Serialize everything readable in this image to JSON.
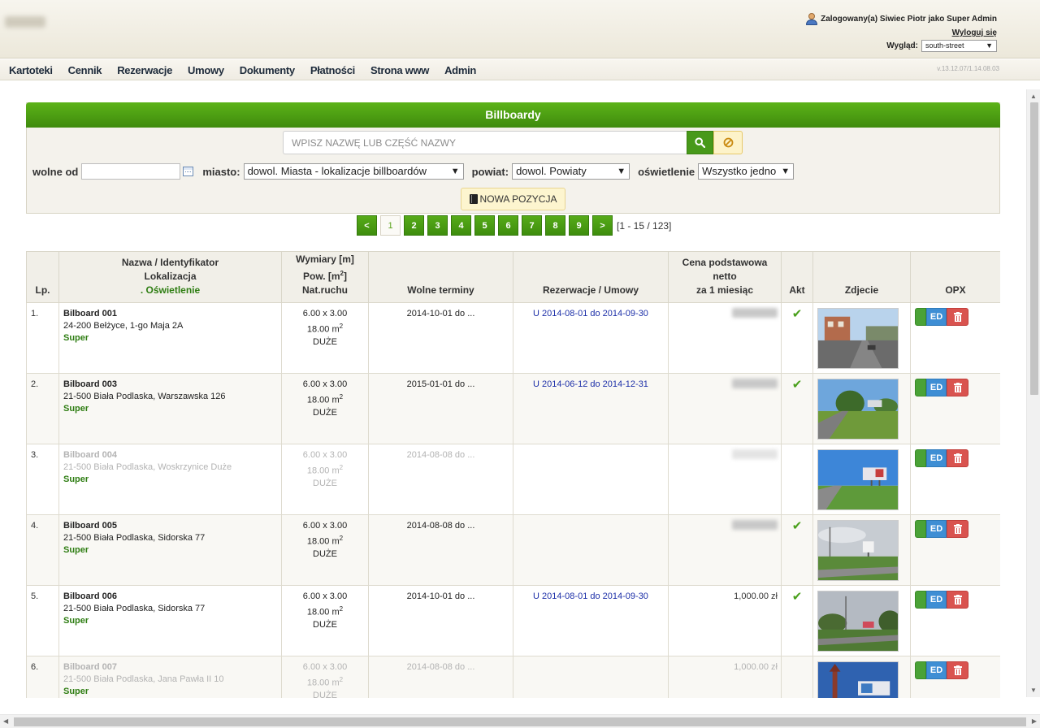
{
  "header": {
    "user_text": "Zalogowany(a) Siwiec Piotr jako Super Admin",
    "logout_label": "Wyloguj się",
    "look_label": "Wygląd:",
    "look_value": "south-street",
    "version": "v.13.12.07/1.14.08.03"
  },
  "menu": {
    "items": [
      "Kartoteki",
      "Cennik",
      "Rezerwacje",
      "Umowy",
      "Dokumenty",
      "Płatności",
      "Strona www",
      "Admin"
    ]
  },
  "panel": {
    "title": "Billboardy",
    "search_placeholder": "WPISZ NAZWĘ LUB CZĘŚĆ NAZWY",
    "filters": {
      "free_from_label": "wolne od",
      "city_label": "miasto:",
      "city_value": "dowol. Miasta - lokalizacje billboardów",
      "county_label": "powiat:",
      "county_value": "dowol. Powiaty",
      "lighting_label": "oświetlenie",
      "lighting_value": "Wszystko jedno"
    },
    "new_button": "NOWA POZYCJA"
  },
  "pager": {
    "prev": "<",
    "pages": [
      "1",
      "2",
      "3",
      "4",
      "5",
      "6",
      "7",
      "8",
      "9"
    ],
    "next": ">",
    "info": "[1 - 15 / 123]"
  },
  "table": {
    "headers": {
      "lp": "Lp.",
      "name_l1": "Nazwa / Identyfikator",
      "name_l2": "Lokalizacja",
      "name_l3": ". Oświetlenie",
      "dim_l1": "Wymiary [m]",
      "dim_l2": "Pow. [m",
      "dim_l2_sup": "2",
      "dim_l2_end": "]",
      "dim_l3": "Nat.ruchu",
      "free": "Wolne terminy",
      "res": "Rezerwacje / Umowy",
      "price_l1": "Cena podstawowa",
      "price_l2": "netto",
      "price_l3": "za 1 miesiąc",
      "akt": "Akt",
      "photo": "Zdjecie",
      "opx": "OPX"
    },
    "rows": [
      {
        "lp": "1.",
        "name": "Bilboard 001",
        "addr": "24-200 Bełżyce, 1-go Maja 2A",
        "light": "Super",
        "dim": "6.00 x 3.00",
        "area": "18.00 m",
        "sup": "2",
        "traffic": "DUŻE",
        "free": "2014-10-01 do ...",
        "res": "U 2014-08-01 do 2014-09-30",
        "price": "",
        "akt": "✔",
        "ed": "ED"
      },
      {
        "lp": "2.",
        "name": "Bilboard 003",
        "addr": "21-500 Biała Podlaska, Warszawska 126",
        "light": "Super",
        "dim": "6.00 x 3.00",
        "area": "18.00 m",
        "sup": "2",
        "traffic": "DUŻE",
        "free": "2015-01-01 do ...",
        "res": "U 2014-06-12 do 2014-12-31",
        "price": "",
        "akt": "✔",
        "ed": "ED"
      },
      {
        "lp": "3.",
        "name": "Bilboard 004",
        "addr": "21-500 Biała Podlaska, Woskrzynice Duże",
        "light": "Super",
        "dim": "6.00 x 3.00",
        "area": "18.00 m",
        "sup": "2",
        "traffic": "DUŻE",
        "free": "2014-08-08 do ...",
        "res": "",
        "price": "",
        "akt": "",
        "ed": "ED"
      },
      {
        "lp": "4.",
        "name": "Bilboard 005",
        "addr": "21-500 Biała Podlaska, Sidorska 77",
        "light": "Super",
        "dim": "6.00 x 3.00",
        "area": "18.00 m",
        "sup": "2",
        "traffic": "DUŻE",
        "free": "2014-08-08 do ...",
        "res": "",
        "price": "",
        "akt": "✔",
        "ed": "ED"
      },
      {
        "lp": "5.",
        "name": "Bilboard 006",
        "addr": "21-500 Biała Podlaska, Sidorska 77",
        "light": "Super",
        "dim": "6.00 x 3.00",
        "area": "18.00 m",
        "sup": "2",
        "traffic": "DUŻE",
        "free": "2014-10-01 do ...",
        "res": "U 2014-08-01 do 2014-09-30",
        "price": "1,000.00 zł",
        "akt": "✔",
        "ed": "ED"
      },
      {
        "lp": "6.",
        "name": "Bilboard 007",
        "addr": "21-500 Biała Podlaska, Jana Pawła II 10",
        "light": "Super",
        "dim": "6.00 x 3.00",
        "area": "18.00 m",
        "sup": "2",
        "traffic": "DUŻE",
        "free": "2014-08-08 do ...",
        "res": "",
        "price": "1,000.00 zł",
        "akt": "",
        "ed": "ED"
      }
    ]
  },
  "colors": {
    "accent_green": "#48991a",
    "edit_blue": "#3e8ed4",
    "delete_red": "#d9534f",
    "reservation_blue": "#1c2fa8"
  }
}
